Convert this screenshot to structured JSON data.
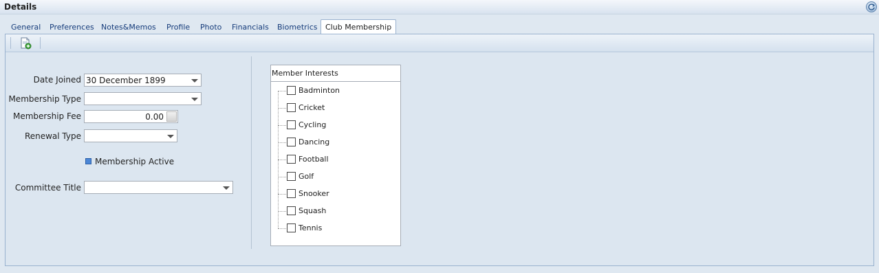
{
  "window": {
    "title": "Details"
  },
  "tabs": [
    "General",
    "Preferences",
    "Notes&Memos",
    "Profile",
    "Photo",
    "Financials",
    "Biometrics",
    "Club Membership"
  ],
  "active_tab": "Club Membership",
  "toolbar": {
    "new_icon": "new-document-icon"
  },
  "form": {
    "date_joined_label": "Date Joined",
    "date_joined_value": "30 December 1899",
    "membership_type_label": "Membership Type",
    "membership_type_value": "",
    "membership_fee_label": "Membership Fee",
    "membership_fee_value": "0.00",
    "renewal_type_label": "Renewal Type",
    "renewal_type_value": "",
    "membership_active_label": "Membership Active",
    "membership_active_checked": true,
    "committee_title_label": "Committee Title",
    "committee_title_value": ""
  },
  "interests": {
    "header": "Member Interests",
    "items": [
      {
        "label": "Badminton",
        "checked": false
      },
      {
        "label": "Cricket",
        "checked": false
      },
      {
        "label": "Cycling",
        "checked": false
      },
      {
        "label": "Dancing",
        "checked": false
      },
      {
        "label": "Football",
        "checked": false
      },
      {
        "label": "Golf",
        "checked": false
      },
      {
        "label": "Snooker",
        "checked": false
      },
      {
        "label": "Squash",
        "checked": false
      },
      {
        "label": "Tennis",
        "checked": false
      }
    ]
  },
  "colors": {
    "accent": "#4b86d6",
    "tab_text": "#153b7a",
    "border": "#99b2cf"
  }
}
